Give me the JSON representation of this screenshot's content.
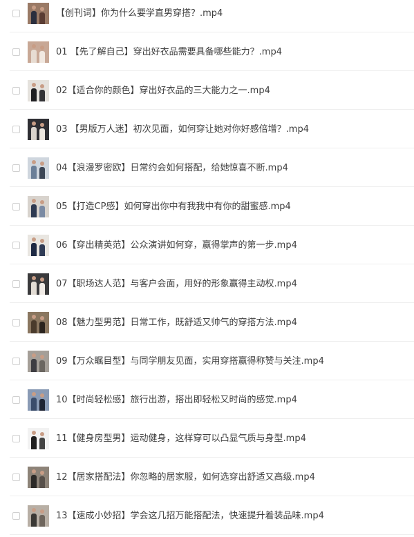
{
  "files": [
    {
      "name": "【创刊词】你为什么要学直男穿搭？.mp4",
      "thumb_colors": [
        "#2b2f3e",
        "#9a7a66",
        "#5a3c33"
      ]
    },
    {
      "name": "01 【先了解自己】穿出好衣品需要具备哪些能力？.mp4",
      "thumb_colors": [
        "#e7dcd2",
        "#c8a896",
        "#f1e8e0"
      ]
    },
    {
      "name": "02【适合你的颜色】穿出好衣品的三大能力之一.mp4",
      "thumb_colors": [
        "#1f1f22",
        "#e5e2dd",
        "#333336"
      ]
    },
    {
      "name": "03 【男版万人迷】初次见面，如何穿让她对你好感倍增？.mp4",
      "thumb_colors": [
        "#d9d3cc",
        "#2e2e33",
        "#ece6df"
      ]
    },
    {
      "name": "04【浪漫罗密欧】日常约会如何搭配，给她惊喜不断.mp4",
      "thumb_colors": [
        "#6b7f98",
        "#cfd6de",
        "#3c4656"
      ]
    },
    {
      "name": "05【打造CP感】如何穿出你中有我我中有你的甜蜜感.mp4",
      "thumb_colors": [
        "#2e3a52",
        "#d8d3cd",
        "#7a8aa3"
      ]
    },
    {
      "name": "06【穿出精英范】公众演讲如何穿，赢得掌声的第一步.mp4",
      "thumb_colors": [
        "#1e2a44",
        "#e9e6e1",
        "#2f3b55"
      ]
    },
    {
      "name": "07【职场达人范】与客户会面，用好的形象赢得主动权.mp4",
      "thumb_colors": [
        "#e2dcd4",
        "#3a3a3c",
        "#f0ebe6"
      ]
    },
    {
      "name": "08【魅力型男范】日常工作，既舒适又帅气的穿搭方法.mp4",
      "thumb_colors": [
        "#4a3b2c",
        "#8a7760",
        "#2a241e"
      ]
    },
    {
      "name": "09【万众瞩目型】与同学朋友见面，实用穿搭赢得称赞与关注.mp4",
      "thumb_colors": [
        "#3e3d42",
        "#a59f98",
        "#6b6660"
      ]
    },
    {
      "name": "10【时尚轻松感】旅行出游，搭出即轻松又时尚的感觉.mp4",
      "thumb_colors": [
        "#3b4d6b",
        "#8a9bb5",
        "#1e2433"
      ]
    },
    {
      "name": "11【健身房型男】运动健身，这样穿可以凸显气质与身型.mp4",
      "thumb_colors": [
        "#1f1f1f",
        "#f2f2f2",
        "#444444"
      ]
    },
    {
      "name": "12【居家搭配法】你忽略的居家服，如何选穿出舒适又高级.mp4",
      "thumb_colors": [
        "#2c2a28",
        "#8d8378",
        "#57504a"
      ]
    },
    {
      "name": "13【速成小妙招】学会这几招万能搭配法，快速提升着装品味.mp4",
      "thumb_colors": [
        "#3a3835",
        "#b8afa5",
        "#6e655c"
      ]
    }
  ]
}
